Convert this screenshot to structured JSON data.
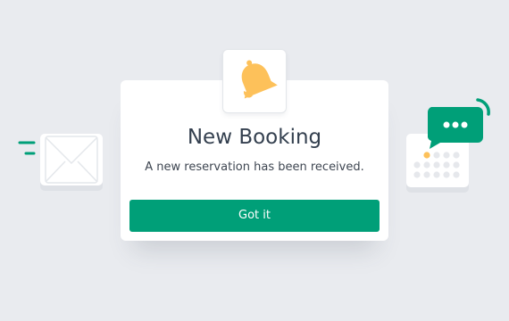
{
  "dialog": {
    "title": "New Booking",
    "message": "A new reservation has been received.",
    "confirm_label": "Got it"
  },
  "icons": {
    "bell": "bell-icon",
    "envelope": "envelope-icon",
    "calendar": "calendar-icon",
    "chat": "chat-bubble-icon"
  },
  "colors": {
    "background": "#E9EBEF",
    "card": "#FFFFFF",
    "accent_green": "#009F78",
    "bell_yellow": "#FDC15A",
    "calendar_highlight": "#FDC15A",
    "title_text": "#34404F"
  }
}
